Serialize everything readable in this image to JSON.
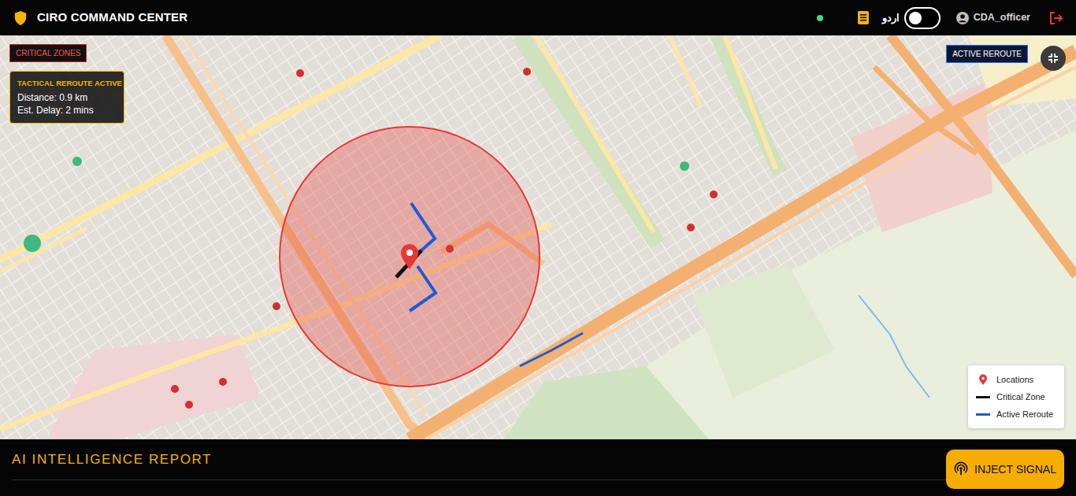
{
  "header": {
    "title": "CIRO COMMAND CENTER",
    "status_online": true,
    "language_label": "اردو",
    "language_toggle_on": false,
    "user": "CDA_officer"
  },
  "map": {
    "critical_zones_badge": "CRITICAL ZONES",
    "active_reroute_badge": "ACTIVE REROUTE",
    "reroute_card": {
      "title": "TACTICAL REROUTE ACTIVE",
      "distance": "Distance: 0.9 km",
      "delay": "Est. Delay: 2 mins"
    },
    "legend": [
      {
        "label": "Locations",
        "kind": "pin",
        "color": "#e53935"
      },
      {
        "label": "Critical Zone",
        "kind": "line",
        "color": "#111111"
      },
      {
        "label": "Active Reroute",
        "kind": "line",
        "color": "#1e5bd6"
      }
    ]
  },
  "report": {
    "title": "AI INTELLIGENCE REPORT"
  },
  "inject_button": "INJECT SIGNAL"
}
